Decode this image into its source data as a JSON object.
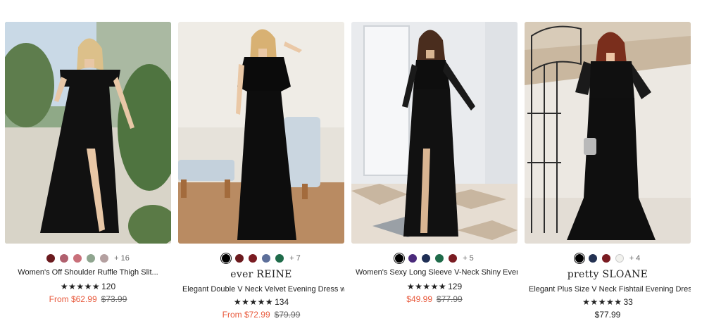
{
  "products": [
    {
      "name": "Women's Off Shoulder Ruffle Thigh Slit...",
      "swatches": [
        "#6b1a1e",
        "#b0606e",
        "#c9707a",
        "#8fa58f",
        "#b4a0a0"
      ],
      "more": "+ 16",
      "rating_stars": "★★★★★",
      "rating": 5,
      "reviews": "120",
      "price": "From $62.99",
      "original_price": "$73.99"
    },
    {
      "brand": "ever REINE",
      "name": "Elegant Double V Neck Velvet Evening Dress wit...",
      "swatches": [
        "#000000",
        "#6b1a1e",
        "#7a1c22",
        "#5d6f9a",
        "#1f6b4a"
      ],
      "more": "+ 7",
      "rating_stars": "★★★★★",
      "rating": 5,
      "reviews": "134",
      "price": "From $72.99",
      "original_price": "$79.99"
    },
    {
      "name": "Women's Sexy Long Sleeve V-Neck Shiny Eveni...",
      "swatches": [
        "#000000",
        "#4b2a7b",
        "#1f2f55",
        "#1f6b4a",
        "#7a1c22"
      ],
      "more": "+ 5",
      "rating_stars": "★★★★★",
      "rating": 5,
      "reviews": "129",
      "price": "$49.99",
      "original_price": "$77.99"
    },
    {
      "brand": "pretty SLOANE",
      "name": "Elegant Plus Size V Neck Fishtail Evening Dress...",
      "swatches": [
        "#000000",
        "#243252",
        "#7a1c22",
        "#f2f2ee"
      ],
      "more": "+ 4",
      "rating_stars": "★★★★★",
      "rating": 5,
      "reviews": "33",
      "price": "$77.99"
    }
  ]
}
